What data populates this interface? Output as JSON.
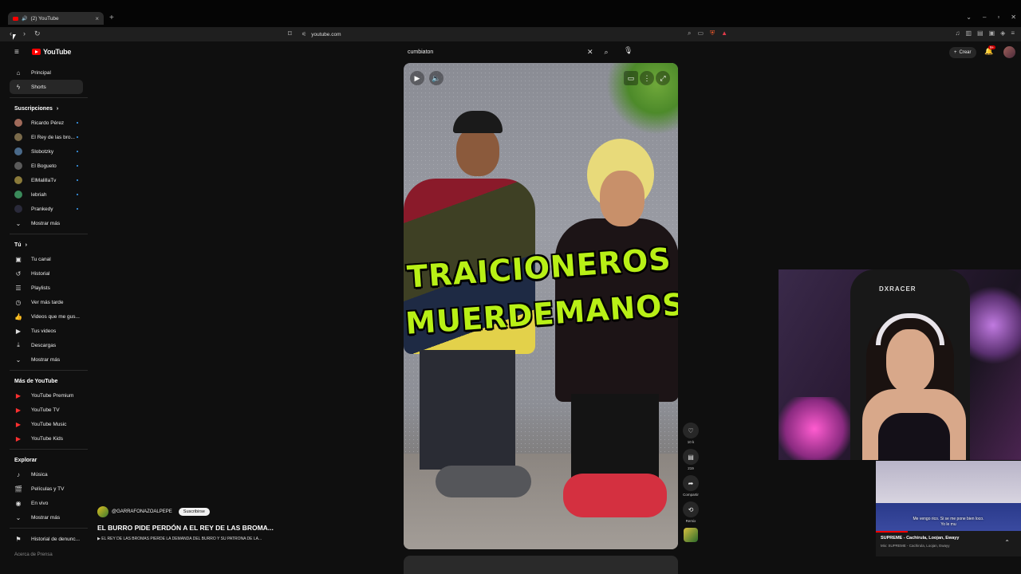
{
  "browser": {
    "tab_title": "(2) YouTube",
    "url": "youtube.com",
    "new_tab": "+",
    "close_tab": "×"
  },
  "header": {
    "logo_text": "YouTube",
    "search_query": "cumbiaton",
    "create_label": "Crear",
    "notification_count": "9+"
  },
  "sidebar": {
    "main": [
      {
        "label": "Principal",
        "icon": "home-icon"
      },
      {
        "label": "Shorts",
        "icon": "shorts-icon"
      }
    ],
    "subscriptions_header": "Suscripciones",
    "subscriptions": [
      {
        "label": "Ricardo Pérez",
        "color": "#a06a5a"
      },
      {
        "label": "El Rey de las bro...",
        "color": "#7a6a4a"
      },
      {
        "label": "Slobotzky",
        "color": "#4a6a8a"
      },
      {
        "label": "El Bogueto",
        "color": "#5a5a5a"
      },
      {
        "label": "ElMalillaTv",
        "color": "#8a7a3a"
      },
      {
        "label": "lebriah",
        "color": "#3a8a5a"
      },
      {
        "label": "Prankedy",
        "color": "#2a2a3a"
      }
    ],
    "show_more_1": "Mostrar más",
    "you_header": "Tú",
    "you_items": [
      {
        "label": "Tu canal",
        "icon": "channel-icon"
      },
      {
        "label": "Historial",
        "icon": "history-icon"
      },
      {
        "label": "Playlists",
        "icon": "playlist-icon"
      },
      {
        "label": "Ver más tarde",
        "icon": "clock-icon"
      },
      {
        "label": "Videos que me gus...",
        "icon": "thumbs-up-icon"
      },
      {
        "label": "Tus videos",
        "icon": "video-icon"
      },
      {
        "label": "Descargas",
        "icon": "download-icon"
      }
    ],
    "show_more_2": "Mostrar más",
    "more_header": "Más de YouTube",
    "more_items": [
      {
        "label": "YouTube Premium"
      },
      {
        "label": "YouTube TV"
      },
      {
        "label": "YouTube Music"
      },
      {
        "label": "YouTube Kids"
      }
    ],
    "explore_header": "Explorar",
    "explore_items": [
      {
        "label": "Música",
        "icon": "music-icon"
      },
      {
        "label": "Películas y TV",
        "icon": "film-icon"
      },
      {
        "label": "En vivo",
        "icon": "live-icon"
      }
    ],
    "show_more_3": "Mostrar más",
    "report_history": "Historial de denunc...",
    "footer_partial": "Acerca de  Prensa"
  },
  "short": {
    "overlay_line1": "TRAICIONEROS",
    "overlay_line2": "MUERDEMANOS",
    "channel": "@GARRAFONAZOALPEPE",
    "subscribe_label": "Suscribirse",
    "title": "EL BURRO PIDE PERDÓN A EL REY DE LAS BROMA...",
    "description": "▶ EL REY DE LAS BROMAS PIERDE LA DEMANDA DEL BURRO Y SU PATRONA DE LA...",
    "likes": "10 k",
    "comments": "219",
    "share_label": "Compartir",
    "remix_label": "Remix"
  },
  "webcam": {
    "chair_brand": "DXRACER"
  },
  "mini_player": {
    "subtitle_1": "Me vengo rico. Si se me pone bien loco.",
    "subtitle_2": "Yo le mu",
    "title": "SUPREME - Cachirula, Loojan, Ewayy",
    "artist": "Mix: SUPREME - Cachirula, Loojan, Ewayy",
    "progress": 0.22
  }
}
